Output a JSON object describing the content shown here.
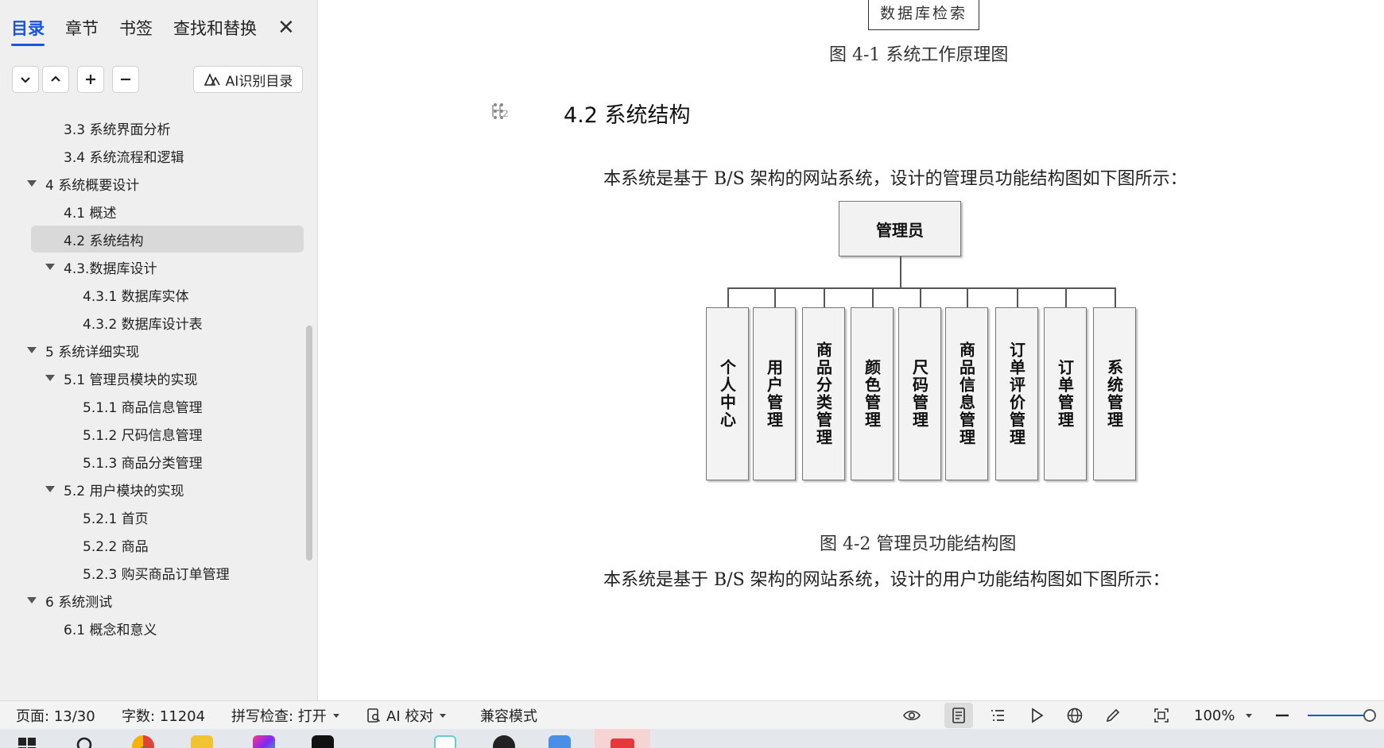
{
  "nav": {
    "tabs": [
      {
        "label": "目录"
      },
      {
        "label": "章节"
      },
      {
        "label": "书签"
      },
      {
        "label": "查找和替换"
      }
    ],
    "close_icon": "close-icon",
    "toolbar": {
      "expand_icon": "chevron-down-icon",
      "collapse_icon": "chevron-up-icon",
      "add_icon": "plus-icon",
      "remove_icon": "minus-icon",
      "ai_toc_label": "AI识别目录"
    },
    "toc": [
      {
        "label": "3.3 系统界面分析"
      },
      {
        "label": "3.4 系统流程和逻辑"
      },
      {
        "label": "4 系统概要设计"
      },
      {
        "label": "4.1 概述"
      },
      {
        "label": "4.2 系统结构"
      },
      {
        "label": "4.3.数据库设计"
      },
      {
        "label": "4.3.1 数据库实体"
      },
      {
        "label": "4.3.2 数据库设计表"
      },
      {
        "label": "5 系统详细实现"
      },
      {
        "label": "5.1  管理员模块的实现"
      },
      {
        "label": "5.1.1  商品信息管理"
      },
      {
        "label": "5.1.2  尺码信息管理"
      },
      {
        "label": "5.1.3  商品分类管理"
      },
      {
        "label": "5.2  用户模块的实现"
      },
      {
        "label": "5.2.1  首页"
      },
      {
        "label": "5.2.2  商品"
      },
      {
        "label": "5.2.3  购买商品订单管理"
      },
      {
        "label": "6 系统测试"
      },
      {
        "label": "6.1 概念和意义"
      }
    ]
  },
  "doc": {
    "fig1_box_label": "数据库检索",
    "fig1_caption": "图 4-1 系统工作原理图",
    "heading_marker": "H₂",
    "heading": "4.2 系统结构",
    "para1": "本系统是基于 B/S 架构的网站系统，设计的管理员功能结构图如下图所示：",
    "org_root": "管理员",
    "org_children": [
      "个人中心",
      "用户管理",
      "商品分类管理",
      "颜色管理",
      "尺码管理",
      "商品信息管理",
      "订单评价管理",
      "订单管理",
      "系统管理"
    ],
    "fig2_caption": "图 4-2 管理员功能结构图",
    "para2": "本系统是基于 B/S 架构的网站系统，设计的用户功能结构图如下图所示："
  },
  "status": {
    "page": "页面: 13/30",
    "words": "字数: 11204",
    "spell": "拼写检查: 打开",
    "ai_proof": "AI 校对",
    "compat": "兼容模式",
    "zoom": "100%",
    "zoom_level": 1.0,
    "view_icons": [
      "eye-icon",
      "page-view-icon",
      "outline-view-icon",
      "play-icon",
      "web-view-icon",
      "pen-icon",
      "fit-screen-icon"
    ]
  },
  "taskbar": {
    "icons": [
      "windows-start-icon",
      "search-icon",
      "chrome-icon",
      "folder-app-icon",
      "jetbrains-icon",
      "terminal-icon",
      "qq-icon",
      "vpn-icon",
      "file-explorer-icon",
      "wps-icon"
    ]
  }
}
